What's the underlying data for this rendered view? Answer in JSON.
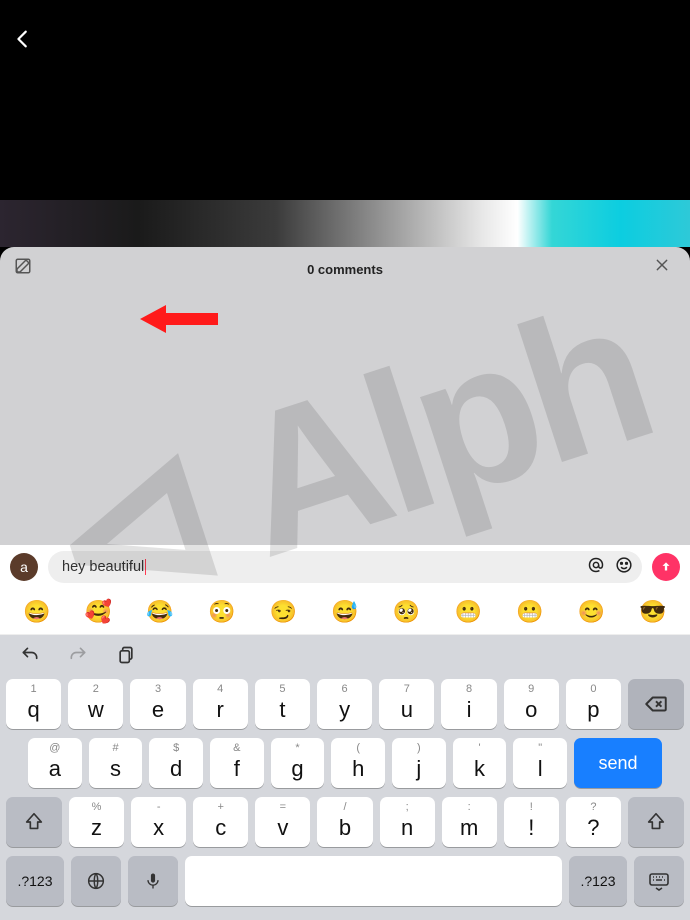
{
  "header": {
    "comments_label": "0 comments"
  },
  "input": {
    "avatar_letter": "a",
    "text": "hey beautiful"
  },
  "emoji_bar": [
    "😄",
    "🥰",
    "😂",
    "😳",
    "😏",
    "😅",
    "🥺",
    "😬",
    "😬",
    "😊",
    "😎"
  ],
  "keyboard": {
    "row1": [
      {
        "sub": "1",
        "main": "q"
      },
      {
        "sub": "2",
        "main": "w"
      },
      {
        "sub": "3",
        "main": "e"
      },
      {
        "sub": "4",
        "main": "r"
      },
      {
        "sub": "5",
        "main": "t"
      },
      {
        "sub": "6",
        "main": "y"
      },
      {
        "sub": "7",
        "main": "u"
      },
      {
        "sub": "8",
        "main": "i"
      },
      {
        "sub": "9",
        "main": "o"
      },
      {
        "sub": "0",
        "main": "p"
      }
    ],
    "row2": [
      {
        "sub": "@",
        "main": "a"
      },
      {
        "sub": "#",
        "main": "s"
      },
      {
        "sub": "$",
        "main": "d"
      },
      {
        "sub": "&",
        "main": "f"
      },
      {
        "sub": "*",
        "main": "g"
      },
      {
        "sub": "(",
        "main": "h"
      },
      {
        "sub": ")",
        "main": "j"
      },
      {
        "sub": "'",
        "main": "k"
      },
      {
        "sub": "\"",
        "main": "l"
      }
    ],
    "row3": [
      {
        "sub": "%",
        "main": "z"
      },
      {
        "sub": "-",
        "main": "x"
      },
      {
        "sub": "+",
        "main": "c"
      },
      {
        "sub": "=",
        "main": "v"
      },
      {
        "sub": "/",
        "main": "b"
      },
      {
        "sub": ";",
        "main": "n"
      },
      {
        "sub": ":",
        "main": "m"
      },
      {
        "sub": "!",
        "main": "!"
      },
      {
        "sub": "?",
        "main": "?"
      }
    ],
    "send_label": "send",
    "mode_label": ".?123"
  },
  "watermark": "⊲ Alph"
}
